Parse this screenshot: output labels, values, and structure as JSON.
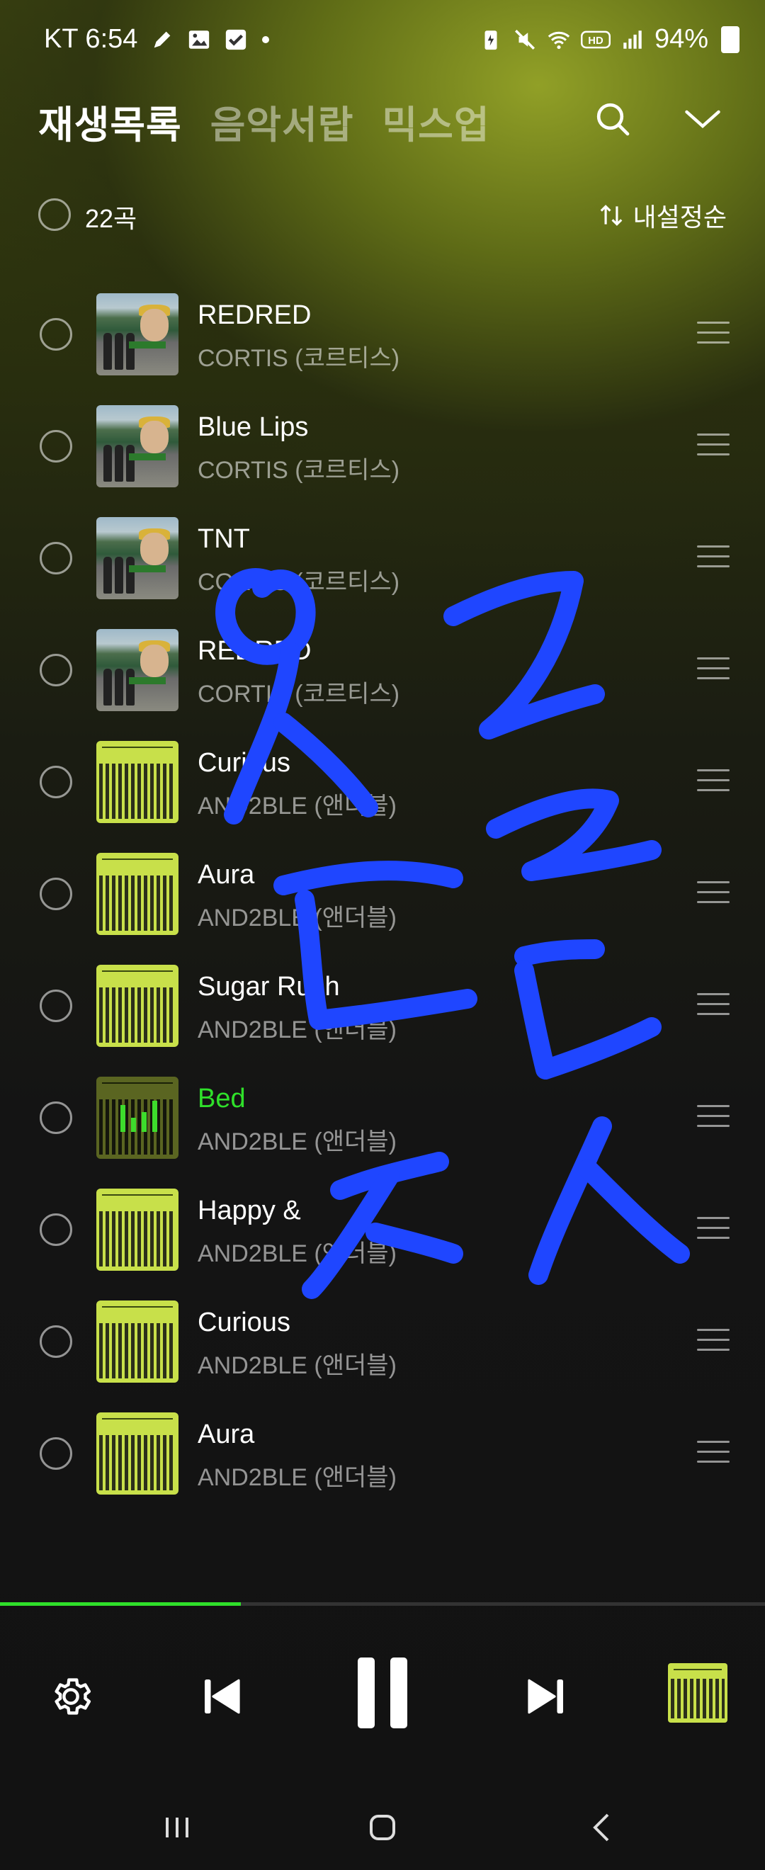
{
  "status_bar": {
    "carrier_time": "KT 6:54",
    "battery": "94%",
    "left_icons": [
      "pencil-icon",
      "image-icon",
      "checkbox-icon",
      "dot-icon"
    ],
    "right_icons": [
      "battery-saver-icon",
      "mute-icon",
      "wifi-icon",
      "hd-icon",
      "signal-icon"
    ]
  },
  "header": {
    "tabs": [
      {
        "label": "재생목록",
        "active": true
      },
      {
        "label": "음악서랍",
        "active": false
      },
      {
        "label": "믹스업",
        "active": false
      }
    ]
  },
  "list_header": {
    "count": "22곡",
    "sort_label": "내설정순"
  },
  "tracks": [
    {
      "title": "REDRED",
      "artist": "CORTIS (코르티스)",
      "art": "cortis",
      "playing": false
    },
    {
      "title": "Blue Lips",
      "artist": "CORTIS (코르티스)",
      "art": "cortis",
      "playing": false
    },
    {
      "title": "TNT",
      "artist": "CORTIS (코르티스)",
      "art": "cortis",
      "playing": false
    },
    {
      "title": "REDRED",
      "artist": "CORTIS (코르티스)",
      "art": "cortis",
      "playing": false
    },
    {
      "title": "Curious",
      "artist": "AND2BLE (앤더블)",
      "art": "and2ble",
      "playing": false
    },
    {
      "title": "Aura",
      "artist": "AND2BLE (앤더블)",
      "art": "and2ble",
      "playing": false
    },
    {
      "title": "Sugar Rush",
      "artist": "AND2BLE (앤더블)",
      "art": "and2ble",
      "playing": false
    },
    {
      "title": "Bed",
      "artist": "AND2BLE (앤더블)",
      "art": "and2ble",
      "playing": true
    },
    {
      "title": "Happy &",
      "artist": "AND2BLE (앤더블)",
      "art": "and2ble",
      "playing": false
    },
    {
      "title": "Curious",
      "artist": "AND2BLE (앤더블)",
      "art": "and2ble",
      "playing": false
    },
    {
      "title": "Aura",
      "artist": "AND2BLE (앤더블)",
      "art": "and2ble",
      "playing": false
    }
  ],
  "player": {
    "progress": 0.315,
    "accent_color": "#2fe02a"
  },
  "colors": {
    "accent": "#2fe02a",
    "scribble": "#1f46ff"
  }
}
